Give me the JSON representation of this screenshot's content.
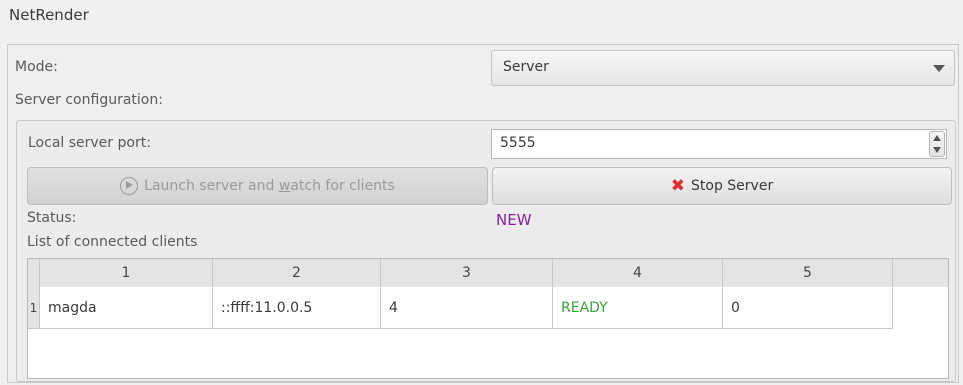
{
  "window": {
    "title": "NetRender"
  },
  "mode": {
    "label": "Mode:",
    "value": "Server"
  },
  "server_config": {
    "label": "Server configuration:",
    "port_label": "Local server port:",
    "port_value": "5555",
    "launch_button": {
      "label_pre": "Launch server and ",
      "label_underlined": "w",
      "label_post": "atch for clients"
    },
    "stop_button": {
      "label": "Stop Server"
    },
    "status_label": "Status:",
    "status_value": "NEW",
    "status_color": "#8a1fa0",
    "clients_label": "List of connected clients"
  },
  "clients_table": {
    "headers": [
      "1",
      "2",
      "3",
      "4",
      "5"
    ],
    "rows": [
      {
        "index": "1",
        "cells": [
          "magda",
          "::ffff:11.0.0.5",
          "4",
          "READY",
          "0"
        ]
      }
    ],
    "ready_color": "#3aa23a"
  },
  "icons": {
    "combo": "chevron-down-icon",
    "spin": "spinner-arrows-icon",
    "launch": "play-circle-icon",
    "stop": "red-x-icon"
  }
}
